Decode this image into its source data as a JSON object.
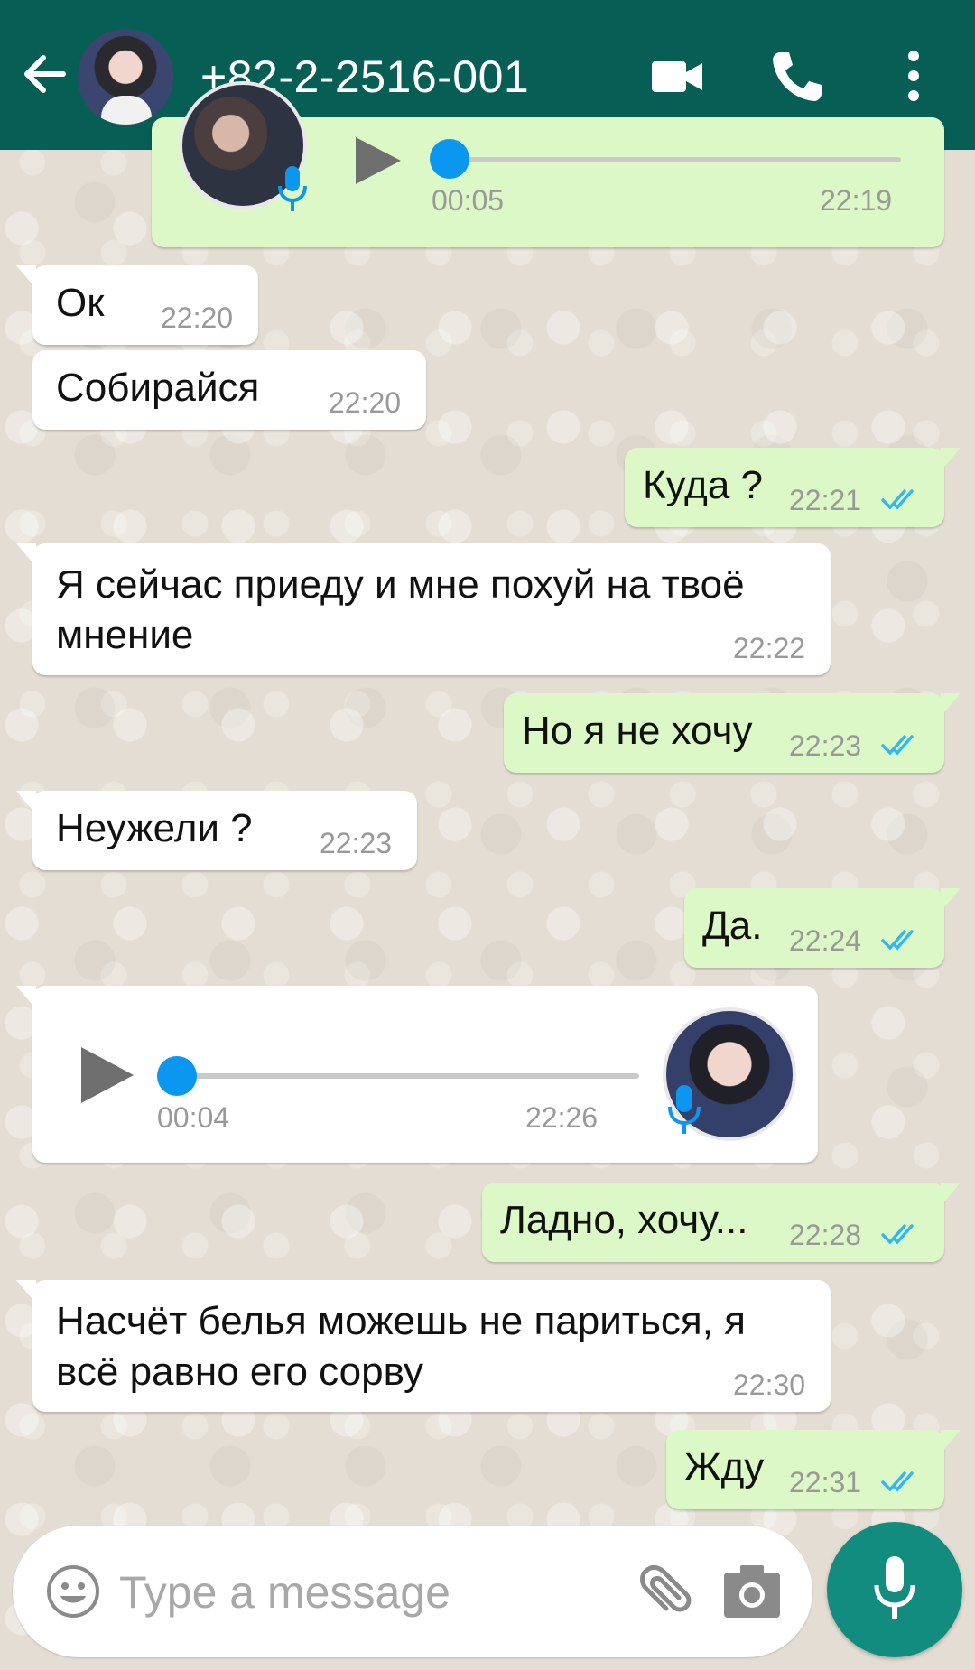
{
  "colors": {
    "header": "#075e54",
    "incoming_bubble": "#ffffff",
    "outgoing_bubble": "#dcf8c6",
    "read_ticks": "#34b7f1",
    "voice_knob": "#0b96f0",
    "fab": "#128c7e"
  },
  "header": {
    "contact_name": "+82-2-2516-001",
    "icons": [
      "back-arrow-icon",
      "video-call-icon",
      "phone-icon",
      "more-vert-icon"
    ]
  },
  "messages": [
    {
      "type": "voice",
      "direction": "out",
      "duration": "00:05",
      "time": "22:19",
      "progress": 0
    },
    {
      "type": "text",
      "direction": "in",
      "text": "Ок",
      "time": "22:20"
    },
    {
      "type": "text",
      "direction": "in",
      "text": "Собирайся",
      "time": "22:20"
    },
    {
      "type": "text",
      "direction": "out",
      "text": "Куда ?",
      "time": "22:21",
      "status": "read"
    },
    {
      "type": "text",
      "direction": "in",
      "text": "Я сейчас приеду и мне похуй на твоё мнение",
      "time": "22:22"
    },
    {
      "type": "text",
      "direction": "out",
      "text": "Но я не хочу",
      "time": "22:23",
      "status": "read"
    },
    {
      "type": "text",
      "direction": "in",
      "text": "Неужели ?",
      "time": "22:23"
    },
    {
      "type": "text",
      "direction": "out",
      "text": "Да.",
      "time": "22:24",
      "status": "read"
    },
    {
      "type": "voice",
      "direction": "in",
      "duration": "00:04",
      "time": "22:26",
      "progress": 0
    },
    {
      "type": "text",
      "direction": "out",
      "text": "Ладно, хочу...",
      "time": "22:28",
      "status": "read"
    },
    {
      "type": "text",
      "direction": "in",
      "text": "Насчёт белья можешь не париться, я всё равно его сорву",
      "time": "22:30"
    },
    {
      "type": "text",
      "direction": "out",
      "text": "Жду",
      "time": "22:31",
      "status": "read"
    }
  ],
  "input": {
    "placeholder": "Type a message",
    "icons": [
      "emoji-icon",
      "attach-icon",
      "camera-icon",
      "mic-icon"
    ]
  }
}
